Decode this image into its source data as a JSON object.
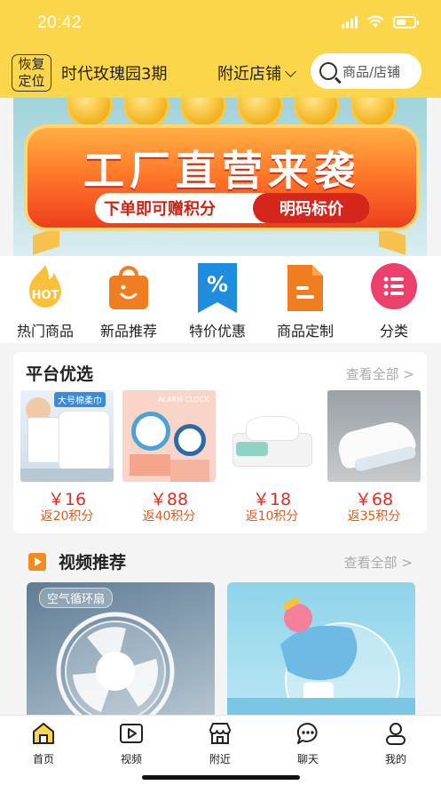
{
  "status": {
    "time": "20:42"
  },
  "header": {
    "restore_line1": "恢复",
    "restore_line2": "定位",
    "location": "时代玫瑰园3期",
    "nearby_label": "附近店铺",
    "search_placeholder": "商品/店铺"
  },
  "banner": {
    "title": "工厂直营来袭",
    "sub_left": "下单即可赠积分",
    "sub_right": "明码标价",
    "badge": "HOT"
  },
  "categories": [
    {
      "label": "热门商品",
      "icon": "hot-icon"
    },
    {
      "label": "新品推荐",
      "icon": "shopping-bag-icon"
    },
    {
      "label": "特价优惠",
      "icon": "percent-tag-icon"
    },
    {
      "label": "商品定制",
      "icon": "document-icon"
    },
    {
      "label": "分类",
      "icon": "list-icon"
    }
  ],
  "platform": {
    "title": "平台优选",
    "see_all": "查看全部 >",
    "products": [
      {
        "price": "￥16",
        "points": "返20积分",
        "img_text": "大号棉柔巾"
      },
      {
        "price": "￥88",
        "points": "返40积分",
        "img_text": "ALARM CLOCK"
      },
      {
        "price": "￥18",
        "points": "返10积分",
        "img_text": ""
      },
      {
        "price": "￥68",
        "points": "返35积分",
        "img_text": ""
      }
    ]
  },
  "videos": {
    "title": "视频推荐",
    "see_all": "查看全部 >",
    "items": [
      {
        "tag": "空气循环扇"
      },
      {
        "tag": ""
      }
    ]
  },
  "tabs": [
    {
      "label": "首页",
      "icon": "home-icon"
    },
    {
      "label": "视频",
      "icon": "video-icon"
    },
    {
      "label": "附近",
      "icon": "store-icon"
    },
    {
      "label": "聊天",
      "icon": "chat-icon"
    },
    {
      "label": "我的",
      "icon": "user-icon"
    }
  ],
  "colors": {
    "brand_yellow": "#fbd64a",
    "price_red": "#e02d1e"
  }
}
